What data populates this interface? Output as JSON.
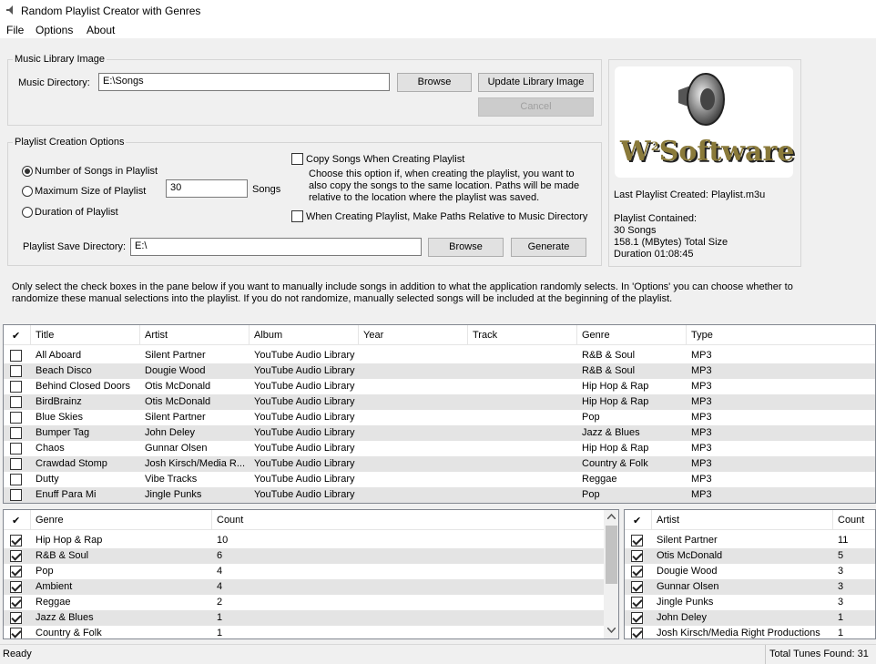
{
  "window": {
    "title": "Random Playlist Creator with Genres"
  },
  "menu": [
    "File",
    "Options",
    "About"
  ],
  "library": {
    "group_label": "Music Library Image",
    "dir_label": "Music Directory:",
    "dir_value": "E:\\Songs",
    "browse_label": "Browse",
    "update_label": "Update Library Image",
    "cancel_label": "Cancel"
  },
  "options": {
    "group_label": "Playlist Creation Options",
    "radio_count": "Number of Songs in Playlist",
    "radio_size": "Maximum Size of Playlist",
    "radio_duration": "Duration of Playlist",
    "count_value": "30",
    "count_unit": "Songs",
    "copy_label": "Copy Songs When Creating Playlist",
    "copy_desc1": "Choose this option if, when creating the playlist, you want to",
    "copy_desc2": "also copy the songs to the same location.  Paths will be made",
    "copy_desc3": "relative to the location where the playlist was saved.",
    "relative_label": "When Creating Playlist, Make Paths Relative to Music Directory",
    "save_dir_label": "Playlist Save Directory:",
    "save_dir_value": "E:\\",
    "browse_label": "Browse",
    "generate_label": "Generate"
  },
  "logo": {
    "w": "W",
    "sup": "2",
    "text": "Software"
  },
  "last": {
    "created": "Last Playlist Created: Playlist.m3u",
    "contained": "Playlist Contained:",
    "songs": "30 Songs",
    "size": "158.1 (MBytes) Total Size",
    "duration": "Duration 01:08:45"
  },
  "info": {
    "line1": "Only select the check boxes in the pane below if you want to manually include songs in addition to what the application randomly selects.  In 'Options' you can choose whether to",
    "line2": "randomize these manual selections into the playlist.  If you do not randomize, manually selected songs will be included at the beginning of the playlist."
  },
  "songs": {
    "headers": {
      "check": "✔",
      "title": "Title",
      "artist": "Artist",
      "album": "Album",
      "year": "Year",
      "track": "Track",
      "genre": "Genre",
      "type": "Type"
    },
    "rows": [
      {
        "title": "All Aboard",
        "artist": "Silent Partner",
        "album": "YouTube Audio Library",
        "genre": "R&B & Soul",
        "type": "MP3"
      },
      {
        "title": "Beach Disco",
        "artist": "Dougie Wood",
        "album": "YouTube Audio Library",
        "genre": "R&B & Soul",
        "type": "MP3"
      },
      {
        "title": "Behind Closed Doors",
        "artist": "Otis McDonald",
        "album": "YouTube Audio Library",
        "genre": "Hip Hop & Rap",
        "type": "MP3"
      },
      {
        "title": "BirdBrainz",
        "artist": "Otis McDonald",
        "album": "YouTube Audio Library",
        "genre": "Hip Hop & Rap",
        "type": "MP3"
      },
      {
        "title": "Blue Skies",
        "artist": "Silent Partner",
        "album": "YouTube Audio Library",
        "genre": "Pop",
        "type": "MP3"
      },
      {
        "title": "Bumper Tag",
        "artist": "John Deley",
        "album": "YouTube Audio Library",
        "genre": "Jazz & Blues",
        "type": "MP3"
      },
      {
        "title": "Chaos",
        "artist": "Gunnar Olsen",
        "album": "YouTube Audio Library",
        "genre": "Hip Hop & Rap",
        "type": "MP3"
      },
      {
        "title": "Crawdad Stomp",
        "artist": "Josh Kirsch/Media R...",
        "album": "YouTube Audio Library",
        "genre": "Country & Folk",
        "type": "MP3"
      },
      {
        "title": "Dutty",
        "artist": "Vibe Tracks",
        "album": "YouTube Audio Library",
        "genre": "Reggae",
        "type": "MP3"
      },
      {
        "title": "Enuff Para Mi",
        "artist": "Jingle Punks",
        "album": "YouTube Audio Library",
        "genre": "Pop",
        "type": "MP3"
      }
    ]
  },
  "genres": {
    "headers": {
      "check": "✔",
      "name": "Genre",
      "count": "Count"
    },
    "rows": [
      {
        "name": "Hip Hop & Rap",
        "count": "10"
      },
      {
        "name": "R&B & Soul",
        "count": "6"
      },
      {
        "name": "Pop",
        "count": "4"
      },
      {
        "name": "Ambient",
        "count": "4"
      },
      {
        "name": "Reggae",
        "count": "2"
      },
      {
        "name": "Jazz & Blues",
        "count": "1"
      },
      {
        "name": "Country & Folk",
        "count": "1"
      }
    ]
  },
  "artists": {
    "headers": {
      "check": "✔",
      "name": "Artist",
      "count": "Count"
    },
    "rows": [
      {
        "name": "Silent Partner",
        "count": "11"
      },
      {
        "name": "Otis McDonald",
        "count": "5"
      },
      {
        "name": "Dougie Wood",
        "count": "3"
      },
      {
        "name": "Gunnar Olsen",
        "count": "3"
      },
      {
        "name": "Jingle Punks",
        "count": "3"
      },
      {
        "name": "John Deley",
        "count": "1"
      },
      {
        "name": "Josh Kirsch/Media Right Productions",
        "count": "1"
      }
    ]
  },
  "status": {
    "left": "Ready",
    "right": "Total Tunes Found: 31"
  }
}
